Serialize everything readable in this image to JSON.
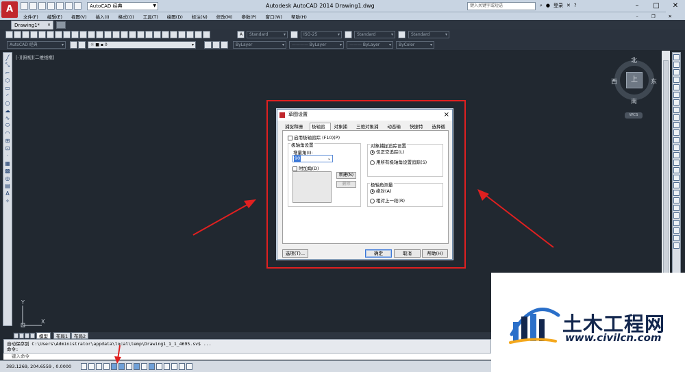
{
  "app": {
    "logo_letter": "A",
    "workspace": "AutoCAD 经典",
    "title": "Autodesk AutoCAD 2014    Drawing1.dwg",
    "search_placeholder": "键入关键字或短语",
    "sign_in": "登录"
  },
  "menu": [
    "文件(F)",
    "编辑(E)",
    "视图(V)",
    "插入(I)",
    "格式(O)",
    "工具(T)",
    "绘图(D)",
    "标注(N)",
    "修改(M)",
    "参数(P)",
    "窗口(W)",
    "帮助(H)"
  ],
  "tabs": {
    "document": "Drawing1*",
    "close": "×"
  },
  "toolbar": {
    "text_style": "Standard",
    "dim_style": "ISO-25",
    "table_style": "Standard",
    "multileader_style": "Standard",
    "workspace2": "AutoCAD 经典",
    "layer": "0",
    "color": "ByLayer",
    "linetype": "ByLayer",
    "lineweight": "ByLayer",
    "plotstyle": "ByColor"
  },
  "viewport": {
    "label": "[-][俯视][二维线框]"
  },
  "viewcube": {
    "north": "北",
    "south": "南",
    "west": "西",
    "east": "东",
    "top": "上",
    "wcs": "WCS"
  },
  "ucs": {
    "x": "X",
    "y": "Y"
  },
  "layout_tabs": {
    "model": "模型",
    "layout1": "布局1",
    "layout2": "布局2"
  },
  "command": {
    "line1": "自动保存到 C:\\Users\\Administrator\\appdata\\local\\temp\\Drawing1_1_1_4695.sv$ ...",
    "line2": "命令:",
    "input_placeholder": "键入命令"
  },
  "status": {
    "coords": "383.1269, 204.6559 , 0.0000"
  },
  "dialog": {
    "title": "草图设置",
    "close": "×",
    "tabs": [
      "捕捉和栅格",
      "极轴追踪",
      "对象捕捉",
      "三维对象捕捉",
      "动态输入",
      "快捷特性",
      "选择循环"
    ],
    "active_tab": 1,
    "enable_polar": "启用极轴追踪 (F10)(P)",
    "polar_angle_group": "极轴角设置",
    "increment_label": "增量角(I):",
    "increment_value": "90",
    "additional_label": "附加角(D)",
    "new_button": "新建(N)",
    "delete_button": "删除",
    "object_snap_group": "对象捕捉追踪设置",
    "orthogonal_only": "仅正交追踪(L)",
    "all_polar": "用所有极轴角设置追踪(S)",
    "measurement_group": "极轴角测量",
    "absolute": "绝对(A)",
    "relative": "相对上一段(R)",
    "options_button": "选项(T)...",
    "ok_button": "确定",
    "cancel_button": "取消",
    "help_button": "帮助(H)"
  },
  "watermark": {
    "name": "土木工程网",
    "url": "www.civilcn.com"
  },
  "colors": {
    "annotation_red": "#e02020",
    "canvas": "#212830",
    "brand_red": "#c1272d",
    "watermark_blue": "#12264d"
  }
}
